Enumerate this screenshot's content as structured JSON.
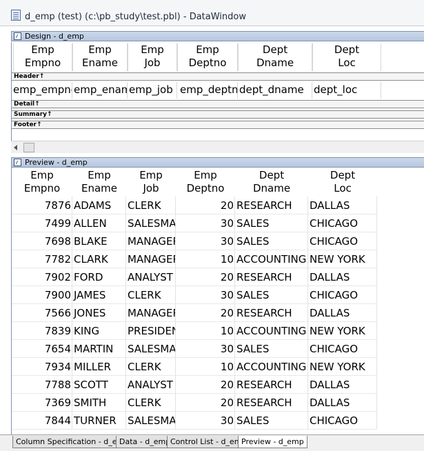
{
  "window": {
    "title": "d_emp  (test) (c:\\pb_study\\test.pbl) - DataWindow"
  },
  "design": {
    "panel_title": "Design - d_emp",
    "headers": [
      {
        "line1": "Emp",
        "line2": "Empno"
      },
      {
        "line1": "Emp",
        "line2": "Ename"
      },
      {
        "line1": "Emp",
        "line2": "Job"
      },
      {
        "line1": "Emp",
        "line2": "Deptno"
      },
      {
        "line1": "Dept",
        "line2": "Dname"
      },
      {
        "line1": "Dept",
        "line2": "Loc"
      }
    ],
    "bands": {
      "header": "Header↑",
      "detail": "Detail↑",
      "summary": "Summary↑",
      "footer": "Footer↑"
    },
    "columns": [
      "emp_empno",
      "emp_ename",
      "emp_job",
      "emp_deptno",
      "dept_dname",
      "dept_loc"
    ]
  },
  "preview": {
    "panel_title": "Preview - d_emp",
    "headers": [
      {
        "line1": "Emp",
        "line2": "Empno"
      },
      {
        "line1": "Emp",
        "line2": "Ename"
      },
      {
        "line1": "Emp",
        "line2": "Job"
      },
      {
        "line1": "Emp",
        "line2": "Deptno"
      },
      {
        "line1": "Dept",
        "line2": "Dname"
      },
      {
        "line1": "Dept",
        "line2": "Loc"
      }
    ],
    "rows": [
      [
        "7876",
        "ADAMS",
        "CLERK",
        "20",
        "RESEARCH",
        "DALLAS"
      ],
      [
        "7499",
        "ALLEN",
        "SALESMAN",
        "30",
        "SALES",
        "CHICAGO"
      ],
      [
        "7698",
        "BLAKE",
        "MANAGER",
        "30",
        "SALES",
        "CHICAGO"
      ],
      [
        "7782",
        "CLARK",
        "MANAGER",
        "10",
        "ACCOUNTING",
        "NEW YORK"
      ],
      [
        "7902",
        "FORD",
        "ANALYST",
        "20",
        "RESEARCH",
        "DALLAS"
      ],
      [
        "7900",
        "JAMES",
        "CLERK",
        "30",
        "SALES",
        "CHICAGO"
      ],
      [
        "7566",
        "JONES",
        "MANAGER",
        "20",
        "RESEARCH",
        "DALLAS"
      ],
      [
        "7839",
        "KING",
        "PRESIDENT",
        "10",
        "ACCOUNTING",
        "NEW YORK"
      ],
      [
        "7654",
        "MARTIN",
        "SALESMAN",
        "30",
        "SALES",
        "CHICAGO"
      ],
      [
        "7934",
        "MILLER",
        "CLERK",
        "10",
        "ACCOUNTING",
        "NEW YORK"
      ],
      [
        "7788",
        "SCOTT",
        "ANALYST",
        "20",
        "RESEARCH",
        "DALLAS"
      ],
      [
        "7369",
        "SMITH",
        "CLERK",
        "20",
        "RESEARCH",
        "DALLAS"
      ],
      [
        "7844",
        "TURNER",
        "SALESMAN",
        "30",
        "SALES",
        "CHICAGO"
      ]
    ]
  },
  "tabs": [
    {
      "label": "Column Specification - d_emp"
    },
    {
      "label": "Data - d_emp"
    },
    {
      "label": "Control List - d_emp"
    },
    {
      "label": "Preview - d_emp",
      "active": true
    }
  ]
}
